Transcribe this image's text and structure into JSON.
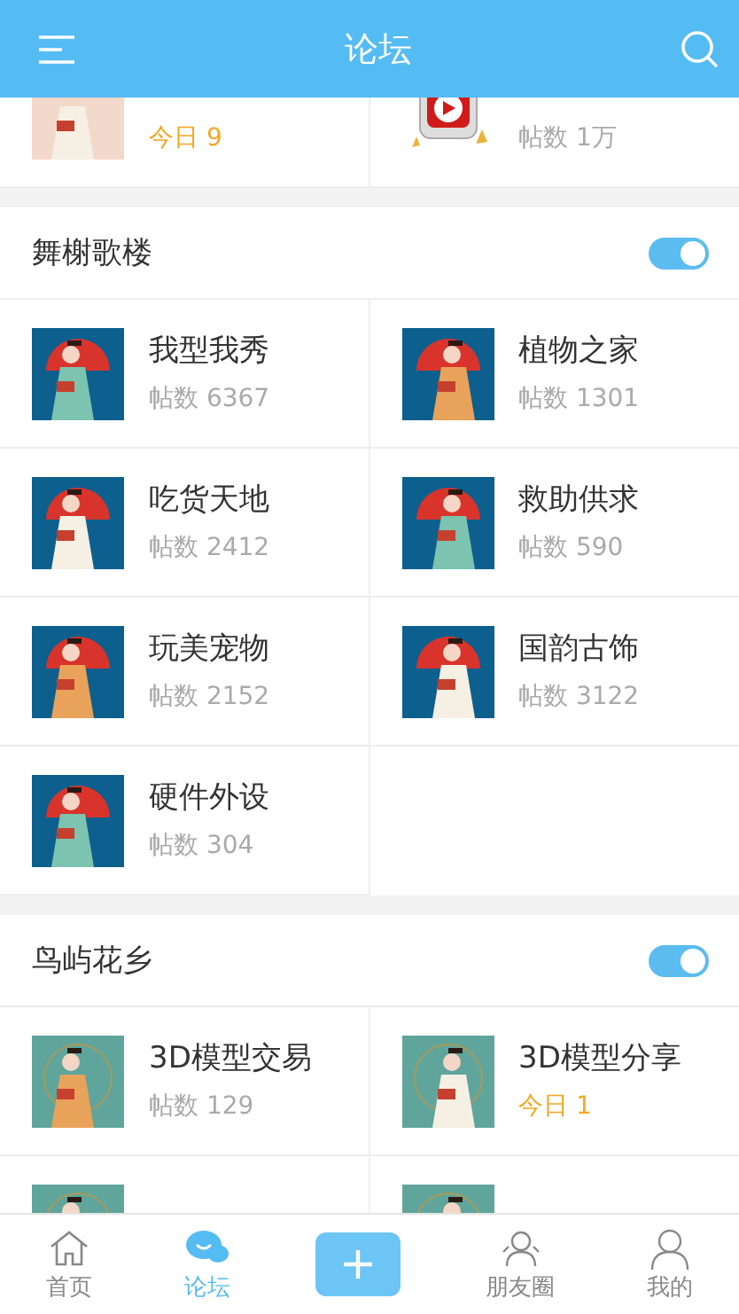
{
  "header": {
    "title": "论坛"
  },
  "top_row": [
    {
      "today": true,
      "stat": "今日 9",
      "kind": "picture"
    },
    {
      "today": false,
      "stat": "帖数 1万",
      "kind": "icon"
    }
  ],
  "sections": [
    {
      "title": "舞榭歌楼",
      "on": true,
      "forums": [
        {
          "name": "我型我秀",
          "today": false,
          "stat": "帖数 6367",
          "kind": "picture"
        },
        {
          "name": "植物之家",
          "today": false,
          "stat": "帖数 1301",
          "kind": "picture"
        },
        {
          "name": "吃货天地",
          "today": false,
          "stat": "帖数 2412",
          "kind": "picture"
        },
        {
          "name": "救助供求",
          "today": false,
          "stat": "帖数 590",
          "kind": "picture"
        },
        {
          "name": "玩美宠物",
          "today": false,
          "stat": "帖数 2152",
          "kind": "picture"
        },
        {
          "name": "国韵古饰",
          "today": false,
          "stat": "帖数 3122",
          "kind": "picture"
        },
        {
          "name": "硬件外设",
          "today": false,
          "stat": "帖数 304",
          "kind": "picture"
        }
      ]
    },
    {
      "title": "鸟屿花乡",
      "on": true,
      "forums": [
        {
          "name": "3D模型交易",
          "today": false,
          "stat": "帖数 129",
          "kind": "picture"
        },
        {
          "name": "3D模型分享",
          "today": true,
          "stat": "今日 1",
          "kind": "picture"
        },
        {
          "kind": "picture"
        },
        {
          "kind": "picture"
        }
      ]
    }
  ],
  "tabs": [
    {
      "label": "首页",
      "kind": "home",
      "selected": false
    },
    {
      "label": "论坛",
      "kind": "chat",
      "selected": true
    },
    {
      "kind": "plus",
      "selected": false
    },
    {
      "label": "朋友圈",
      "kind": "friends",
      "selected": false
    },
    {
      "label": "我的",
      "kind": "me",
      "selected": false
    }
  ]
}
